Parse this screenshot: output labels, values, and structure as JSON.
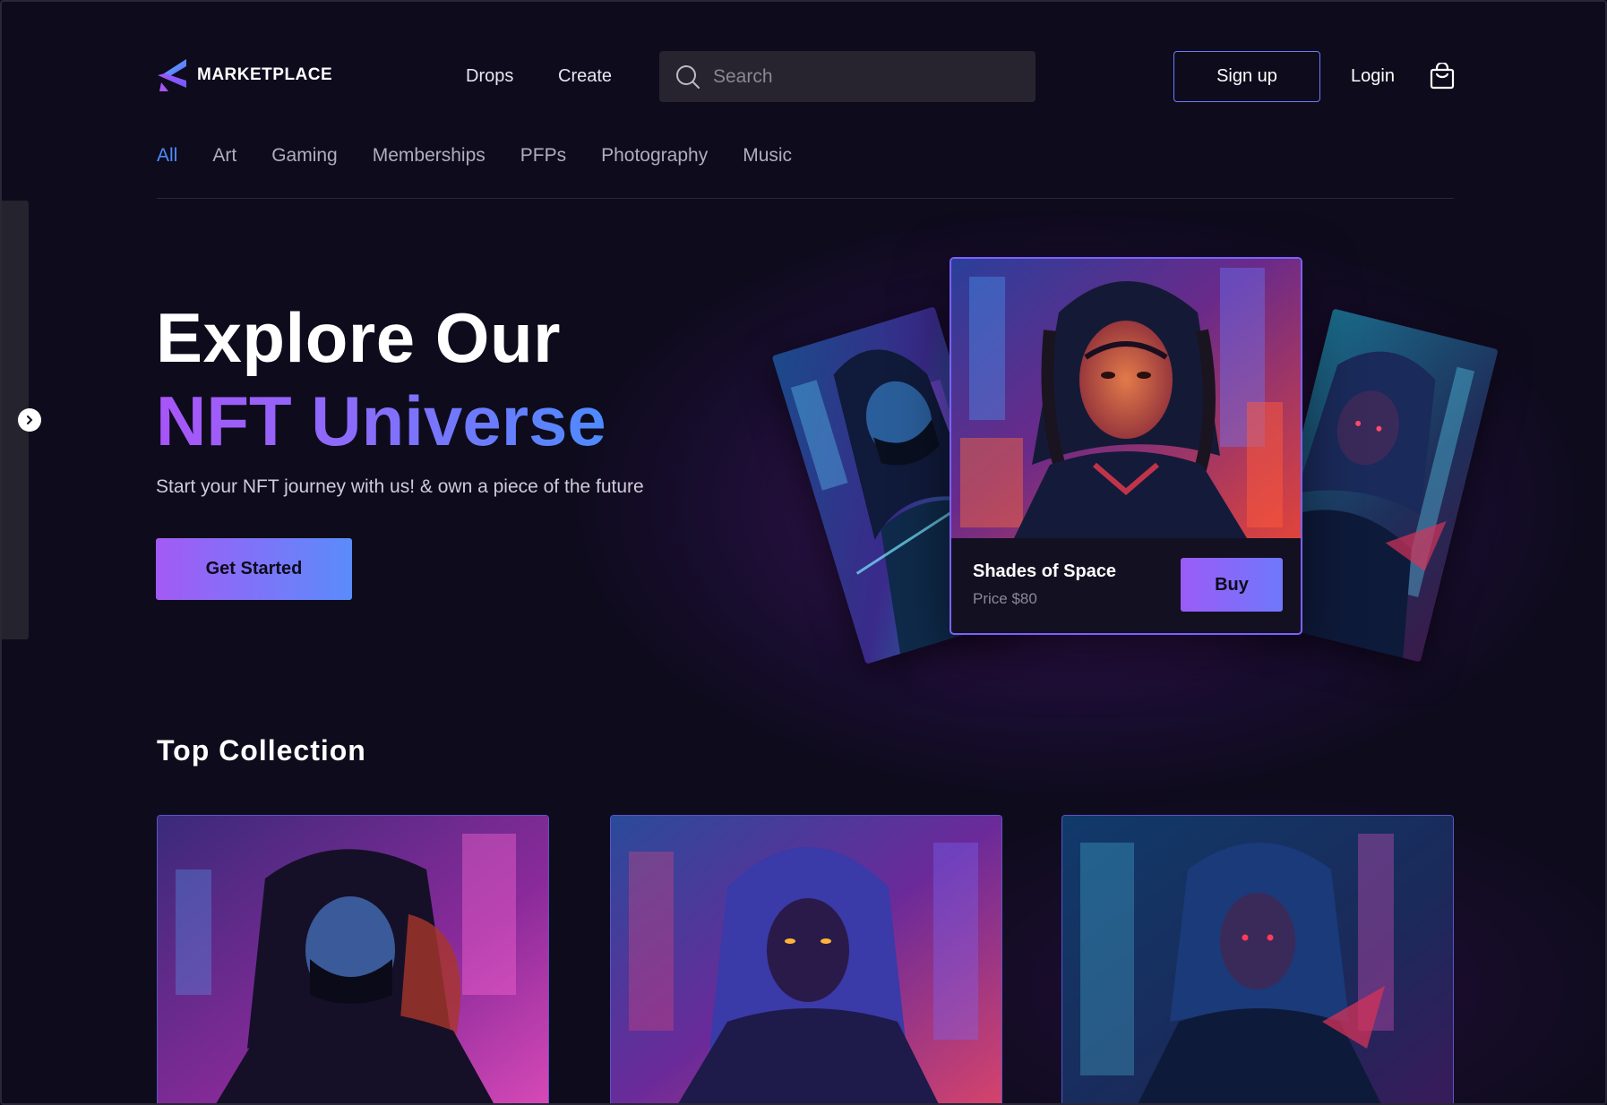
{
  "header": {
    "logo_text": "MARKETPLACE",
    "nav": {
      "drops": "Drops",
      "create": "Create"
    },
    "search": {
      "placeholder": "Search",
      "value": ""
    },
    "signup_label": "Sign up",
    "login_label": "Login",
    "icons": {
      "logo": "marketplace-logo-icon",
      "search": "search-icon",
      "cart": "shopping-bag-icon"
    }
  },
  "categories": {
    "active": "All",
    "items": [
      "All",
      "Art",
      "Gaming",
      "Memberships",
      "PFPs",
      "Photography",
      "Music"
    ]
  },
  "drawer": {
    "toggle_icon": "chevron-right-icon"
  },
  "hero": {
    "title_line1": "Explore Our",
    "title_line2": "NFT Universe",
    "subtitle": "Start your NFT journey with us! & own a piece of the future",
    "cta_label": "Get Started"
  },
  "featured": {
    "title": "Shades of Space",
    "price": "Price $80",
    "buy_label": "Buy"
  },
  "collection": {
    "title": "Top Collection"
  },
  "colors": {
    "background": "#0e0b1c",
    "accent_blue": "#4d8bff",
    "accent_purple": "#a855f7",
    "border_indigo": "#6d7bff"
  }
}
